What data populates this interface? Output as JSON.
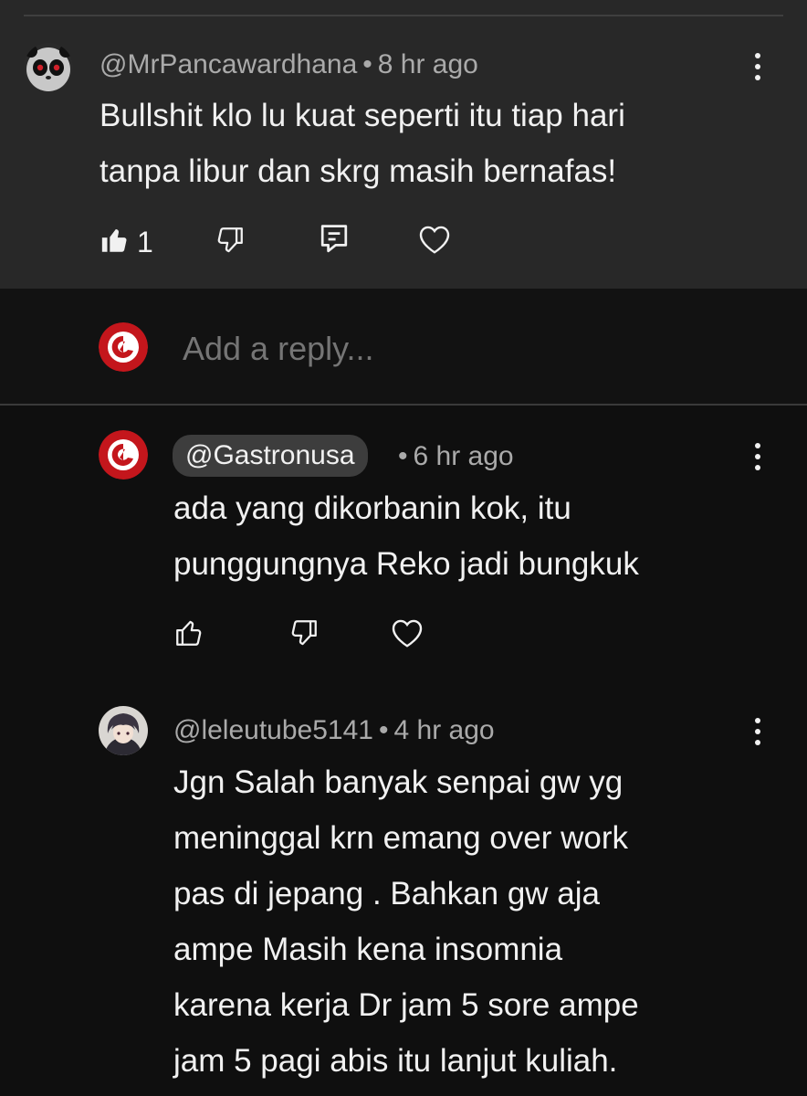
{
  "parent_comment": {
    "author": "@MrPancawardhana",
    "separator": "•",
    "time": "8 hr ago",
    "text_line1": "Bullshit klo lu kuat seperti itu tiap hari",
    "text_line2": "tanpa libur dan skrg masih bernafas!",
    "like_count": "1"
  },
  "reply_box": {
    "placeholder": "Add a reply..."
  },
  "replies": [
    {
      "author": "@Gastronusa",
      "separator": "•",
      "time": "6 hr ago",
      "lines": [
        "ada yang dikorbanin kok, itu",
        "punggungnya Reko jadi bungkuk"
      ]
    },
    {
      "author": "@leleutube5141",
      "separator": "•",
      "time": "4 hr ago",
      "lines": [
        "Jgn Salah banyak senpai gw yg",
        "meninggal krn emang over work",
        "pas di jepang . Bahkan gw aja",
        "ampe Masih kena insomnia",
        "karena kerja Dr jam 5 sore ampe",
        "jam 5 pagi abis itu lanjut kuliah."
      ]
    }
  ],
  "colors": {
    "background": "#0f0f0f",
    "highlight": "#282828",
    "brand_red": "#c4161c"
  },
  "icons": [
    "panda-avatar",
    "gastronusa-logo",
    "anime-avatar",
    "thumb-up-icon",
    "thumb-down-icon",
    "reply-icon",
    "heart-icon",
    "more-vert-icon"
  ]
}
